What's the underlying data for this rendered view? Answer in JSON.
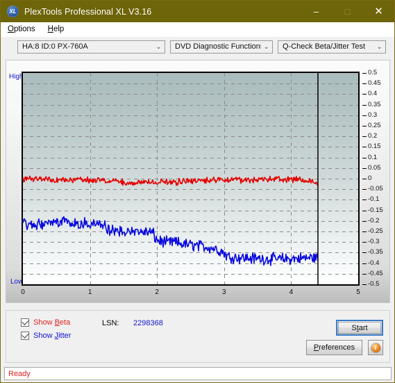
{
  "window": {
    "title": "PlexTools Professional XL V3.16",
    "icon": "xl-app-icon",
    "icon_text": "XL",
    "titlebar_color": "#6e6409",
    "controls": {
      "minimize": "–",
      "maximize": "□",
      "close": "✕"
    }
  },
  "menubar": {
    "items": [
      {
        "label": "Options",
        "mnemonic": "O"
      },
      {
        "label": "Help",
        "mnemonic": "H"
      }
    ]
  },
  "toolbar": {
    "drive_select": {
      "value": "HA:8 ID:0  PX-760A"
    },
    "function_select": {
      "value": "DVD Diagnostic Functions"
    },
    "test_select": {
      "value": "Q-Check Beta/Jitter Test"
    },
    "chevron": "⌄"
  },
  "chart_labels": {
    "high": "High",
    "low": "Low"
  },
  "controls": {
    "show_beta": {
      "label_pre": "Show ",
      "mnemonic": "B",
      "label_post": "eta",
      "checked": true,
      "color": "#e02020"
    },
    "show_jitter": {
      "label_pre": "Show ",
      "mnemonic": "J",
      "label_post": "itter",
      "checked": true,
      "color": "#1414d0"
    },
    "lsn_label": "LSN:",
    "lsn_value": "2298368",
    "start_button": {
      "pre": "S",
      "mnemonic": "t",
      "post": "art",
      "label": "Start"
    },
    "preferences_button": {
      "pre": "",
      "mnemonic": "P",
      "post": "references",
      "label": "Preferences"
    },
    "info_button": {
      "glyph": "i",
      "name": "info-icon"
    }
  },
  "statusbar": {
    "text": "Ready",
    "color": "#e02020"
  },
  "chart_data": {
    "type": "line",
    "title": "Q-Check Beta/Jitter Test",
    "xlabel": "",
    "ylabel": "",
    "xlim": [
      0,
      5
    ],
    "ylim": [
      -0.5,
      0.5
    ],
    "x_ticks": [
      0,
      1,
      2,
      3,
      4,
      5
    ],
    "y_ticks": [
      0.5,
      0.45,
      0.4,
      0.35,
      0.3,
      0.25,
      0.2,
      0.15,
      0.1,
      0.05,
      0,
      -0.05,
      -0.1,
      -0.15,
      -0.2,
      -0.25,
      -0.3,
      -0.35,
      -0.4,
      -0.45,
      -0.5
    ],
    "grid": true,
    "legend_position": "below-left",
    "data_end_x": 4.4,
    "series": [
      {
        "name": "Show Beta",
        "color": "#e60000",
        "noise": 0.012,
        "x": [
          0.0,
          0.15,
          0.3,
          0.45,
          0.6,
          0.75,
          0.9,
          1.05,
          1.2,
          1.3,
          1.4,
          1.5,
          1.55,
          1.6,
          1.7,
          1.8,
          1.9,
          2.0,
          2.1,
          2.2,
          2.3,
          2.4,
          2.5,
          2.6,
          2.7,
          2.8,
          2.9,
          3.0,
          3.1,
          3.2,
          3.3,
          3.4,
          3.5,
          3.6,
          3.7,
          3.8,
          3.9,
          4.0,
          4.1,
          4.2,
          4.3,
          4.4
        ],
        "y": [
          0.0,
          0.0,
          -0.001,
          -0.002,
          -0.003,
          -0.004,
          -0.005,
          -0.006,
          -0.008,
          -0.01,
          -0.013,
          -0.018,
          -0.022,
          -0.02,
          -0.017,
          -0.018,
          -0.02,
          -0.019,
          -0.018,
          -0.016,
          -0.015,
          -0.013,
          -0.011,
          -0.008,
          -0.007,
          -0.006,
          -0.006,
          -0.006,
          -0.006,
          -0.006,
          -0.005,
          -0.005,
          -0.005,
          -0.005,
          -0.004,
          -0.004,
          -0.004,
          -0.004,
          -0.005,
          -0.007,
          -0.012,
          -0.022
        ]
      },
      {
        "name": "Show Jitter",
        "color": "#0a0ae0",
        "noise": 0.022,
        "x": [
          0.0,
          0.1,
          0.2,
          0.3,
          0.4,
          0.5,
          0.55,
          0.6,
          0.65,
          0.7,
          0.8,
          0.9,
          1.0,
          1.1,
          1.18,
          1.22,
          1.26,
          1.3,
          1.4,
          1.5,
          1.6,
          1.7,
          1.8,
          1.9,
          1.94,
          1.98,
          2.05,
          2.15,
          2.25,
          2.35,
          2.45,
          2.55,
          2.65,
          2.75,
          2.85,
          2.95,
          3.0,
          3.05,
          3.15,
          3.25,
          3.4,
          3.55,
          3.7,
          3.85,
          4.0,
          4.15,
          4.3,
          4.4
        ],
        "y": [
          -0.215,
          -0.217,
          -0.219,
          -0.213,
          -0.208,
          -0.206,
          -0.198,
          -0.192,
          -0.199,
          -0.206,
          -0.21,
          -0.214,
          -0.216,
          -0.217,
          -0.218,
          -0.221,
          -0.245,
          -0.25,
          -0.249,
          -0.25,
          -0.251,
          -0.252,
          -0.253,
          -0.254,
          -0.258,
          -0.286,
          -0.296,
          -0.303,
          -0.3,
          -0.307,
          -0.312,
          -0.316,
          -0.32,
          -0.323,
          -0.33,
          -0.341,
          -0.352,
          -0.368,
          -0.372,
          -0.374,
          -0.377,
          -0.379,
          -0.38,
          -0.381,
          -0.379,
          -0.377,
          -0.374,
          -0.372
        ]
      }
    ]
  }
}
